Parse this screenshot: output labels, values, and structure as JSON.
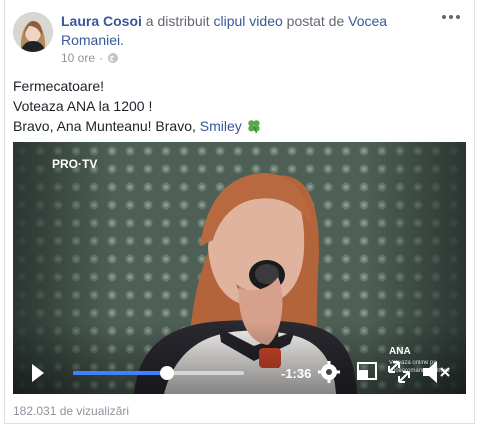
{
  "post": {
    "author": "Laura Cosoi",
    "action_text": "a distribuit",
    "video_link": "clipul video",
    "posted_by_text": "postat de",
    "page_name": "Vocea Romaniei.",
    "time": "10 ore",
    "dot": "·",
    "privacy_icon": "globe-icon",
    "menu_icon": "more-options-icon",
    "text_lines": [
      "Fermecatoare!",
      "Voteaza ANA la 1200 !",
      "Bravo, Ana Munteanu! Bravo, "
    ],
    "mention": "Smiley",
    "emoji_icon": "four-leaf-clover-icon"
  },
  "video": {
    "channel_logo": "PRO·TV",
    "caption_name": "ANA",
    "caption_small_1": "Votează online pe",
    "caption_small_2": "vocearomaniei.protv.ro",
    "time_remaining": "-1:36",
    "progress": 0.55,
    "controls": {
      "play_icon": "play-icon",
      "settings_icon": "gear-icon",
      "pip_icon": "picture-in-picture-icon",
      "fullscreen_icon": "fullscreen-icon",
      "mute_icon": "mute-icon"
    }
  },
  "stats": {
    "views": "182.031 de vizualizări"
  },
  "colors": {
    "link": "#365899",
    "progress": "#4080ff",
    "meta": "#90949c"
  }
}
